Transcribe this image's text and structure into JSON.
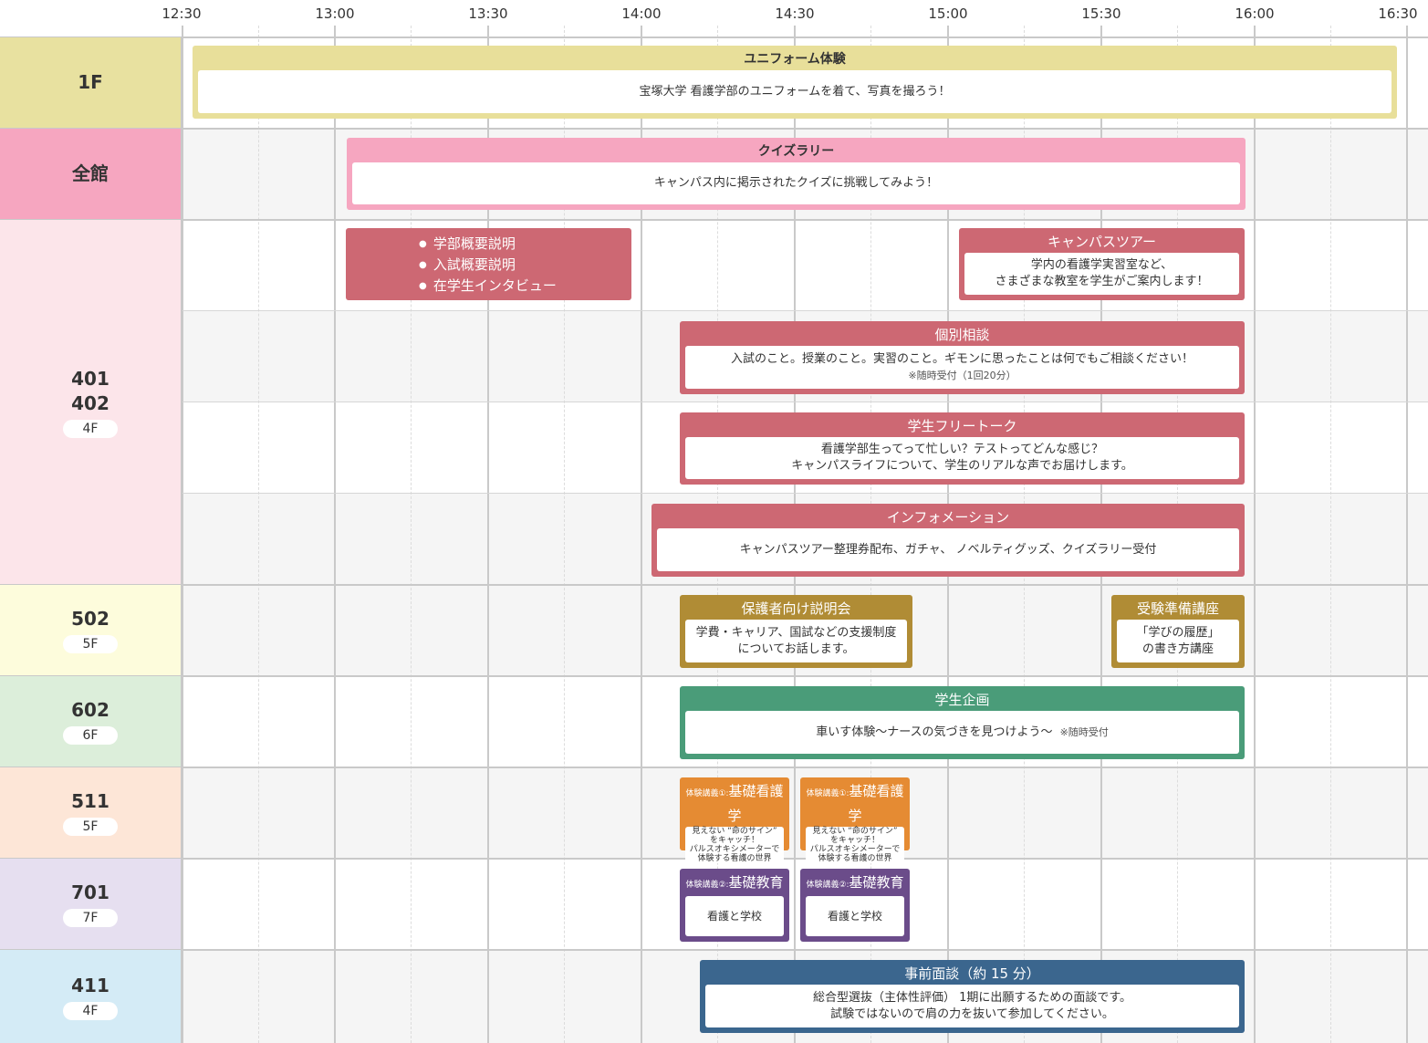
{
  "time_axis": [
    "12:30",
    "13:00",
    "13:30",
    "14:00",
    "14:30",
    "15:00",
    "15:30",
    "16:00",
    "16:30"
  ],
  "colors": {
    "uniform": "#e8df9a",
    "quiz": "#f6a6c0",
    "room401": "#cd6873",
    "parents": "#b08c35",
    "student_plan": "#4a9c79",
    "lecture1": "#e58b33",
    "lecture2": "#6b4c8a",
    "interview": "#3b668e"
  },
  "rows": [
    {
      "room": "1F",
      "floor": "",
      "bg": "#e8e1a0"
    },
    {
      "room": "全館",
      "floor": "",
      "bg": "#f6a6c0"
    },
    {
      "room": "401\n402",
      "floor": "4F",
      "bg": "#fce5ea"
    },
    {
      "room": "502",
      "floor": "5F",
      "bg": "#fdfcdc"
    },
    {
      "room": "602",
      "floor": "6F",
      "bg": "#dceeda"
    },
    {
      "room": "511",
      "floor": "5F",
      "bg": "#fde6d7"
    },
    {
      "room": "701",
      "floor": "7F",
      "bg": "#e6dff0"
    },
    {
      "room": "411",
      "floor": "4F",
      "bg": "#d4ebf6"
    }
  ],
  "events": {
    "uniform": {
      "title": "ユニフォーム体験",
      "desc": "宝塚大学 看護学部のユニフォームを着て、写真を撮ろう！"
    },
    "quiz": {
      "title": "クイズラリー",
      "desc": "キャンパス内に掲示されたクイズに挑戦してみよう！"
    },
    "briefing": {
      "items": [
        "学部概要説明",
        "入試概要説明",
        "在学生インタビュー"
      ]
    },
    "tour": {
      "title": "キャンパスツアー",
      "desc1": "学内の看護学実習室など、",
      "desc2": "さまざまな教室を学生がご案内します！"
    },
    "consult": {
      "title": "個別相談",
      "desc": "入試のこと。授業のこと。実習のこと。ギモンに思ったことは何でもご相談ください！",
      "note": "※随時受付（1回20分）"
    },
    "freetalk": {
      "title": "学生フリートーク",
      "desc1": "看護学部生ってって忙しい？テストってどんな感じ？",
      "desc2": "キャンパスライフについて、学生のリアルな声でお届けします。"
    },
    "info": {
      "title": "インフォメーション",
      "desc": "キャンパスツアー整理券配布、ガチャ、 ノベルティグッズ、クイズラリー受付"
    },
    "parents": {
      "title": "保護者向け説明会",
      "desc1": "学費・キャリア、国試などの支援制度",
      "desc2": "についてお話します。"
    },
    "prep": {
      "title": "受験準備講座",
      "desc1": "「学びの履歴」",
      "desc2": "の書き方講座"
    },
    "student_plan": {
      "title": "学生企画",
      "desc": "車いす体験〜ナースの気づきを見つけよう〜",
      "note": "※随時受付"
    },
    "lecture1": {
      "prefix": "体験講義①:",
      "title": "基礎看護学",
      "desc1": "見えない “命のサイン”",
      "desc2": "をキャッチ！",
      "desc3": "パルスオキシメーターで",
      "desc4": "体験する看護の世界"
    },
    "lecture2": {
      "prefix": "体験講義②:",
      "title": "基礎教育",
      "desc": "看護と学校"
    },
    "interview": {
      "title": "事前面談（約 15 分）",
      "desc1": "総合型選抜（主体性評価） 1期に出願するための面談です。",
      "desc2": "試験ではないので肩の力を抜いて参加してください。"
    }
  }
}
